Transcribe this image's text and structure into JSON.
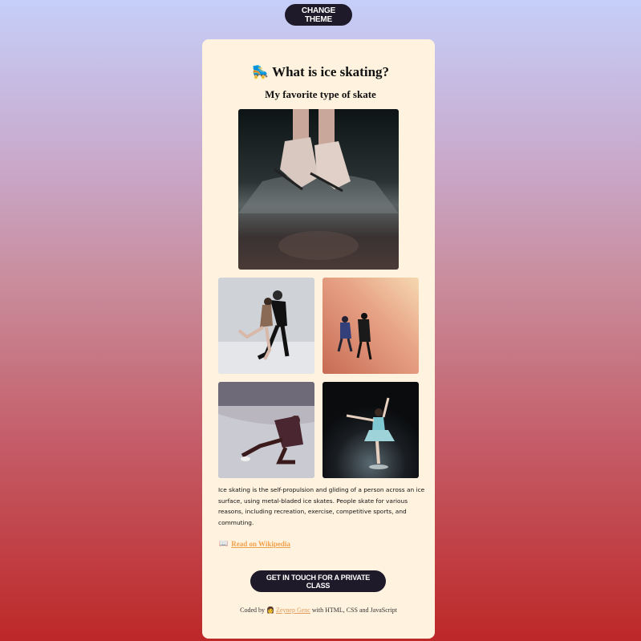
{
  "header": {
    "theme_button": "CHANGE THEME"
  },
  "card": {
    "title_icon": "🛼",
    "title": "What is ice skating?",
    "subtitle": "My favorite type of skate",
    "description": "Ice skating is the self-propulsion and gliding of a person across an ice surface, using metal-bladed ice skates. People skate for various reasons, including recreation, exercise, competitive sports, and commuting.",
    "wiki_icon": "📖",
    "wiki_link": "Read on Wikipedia",
    "cta_button": "GET IN TOUCH FOR A PRIVATE CLASS",
    "footer": {
      "prefix": "Coded by",
      "author_icon": "👩",
      "author": "Zeynep Genc",
      "suffix": "with HTML, CSS and JavaScript"
    }
  },
  "colors": {
    "button_bg": "#1e1a2a",
    "card_bg": "#fff3df",
    "link": "#f0a04b"
  }
}
